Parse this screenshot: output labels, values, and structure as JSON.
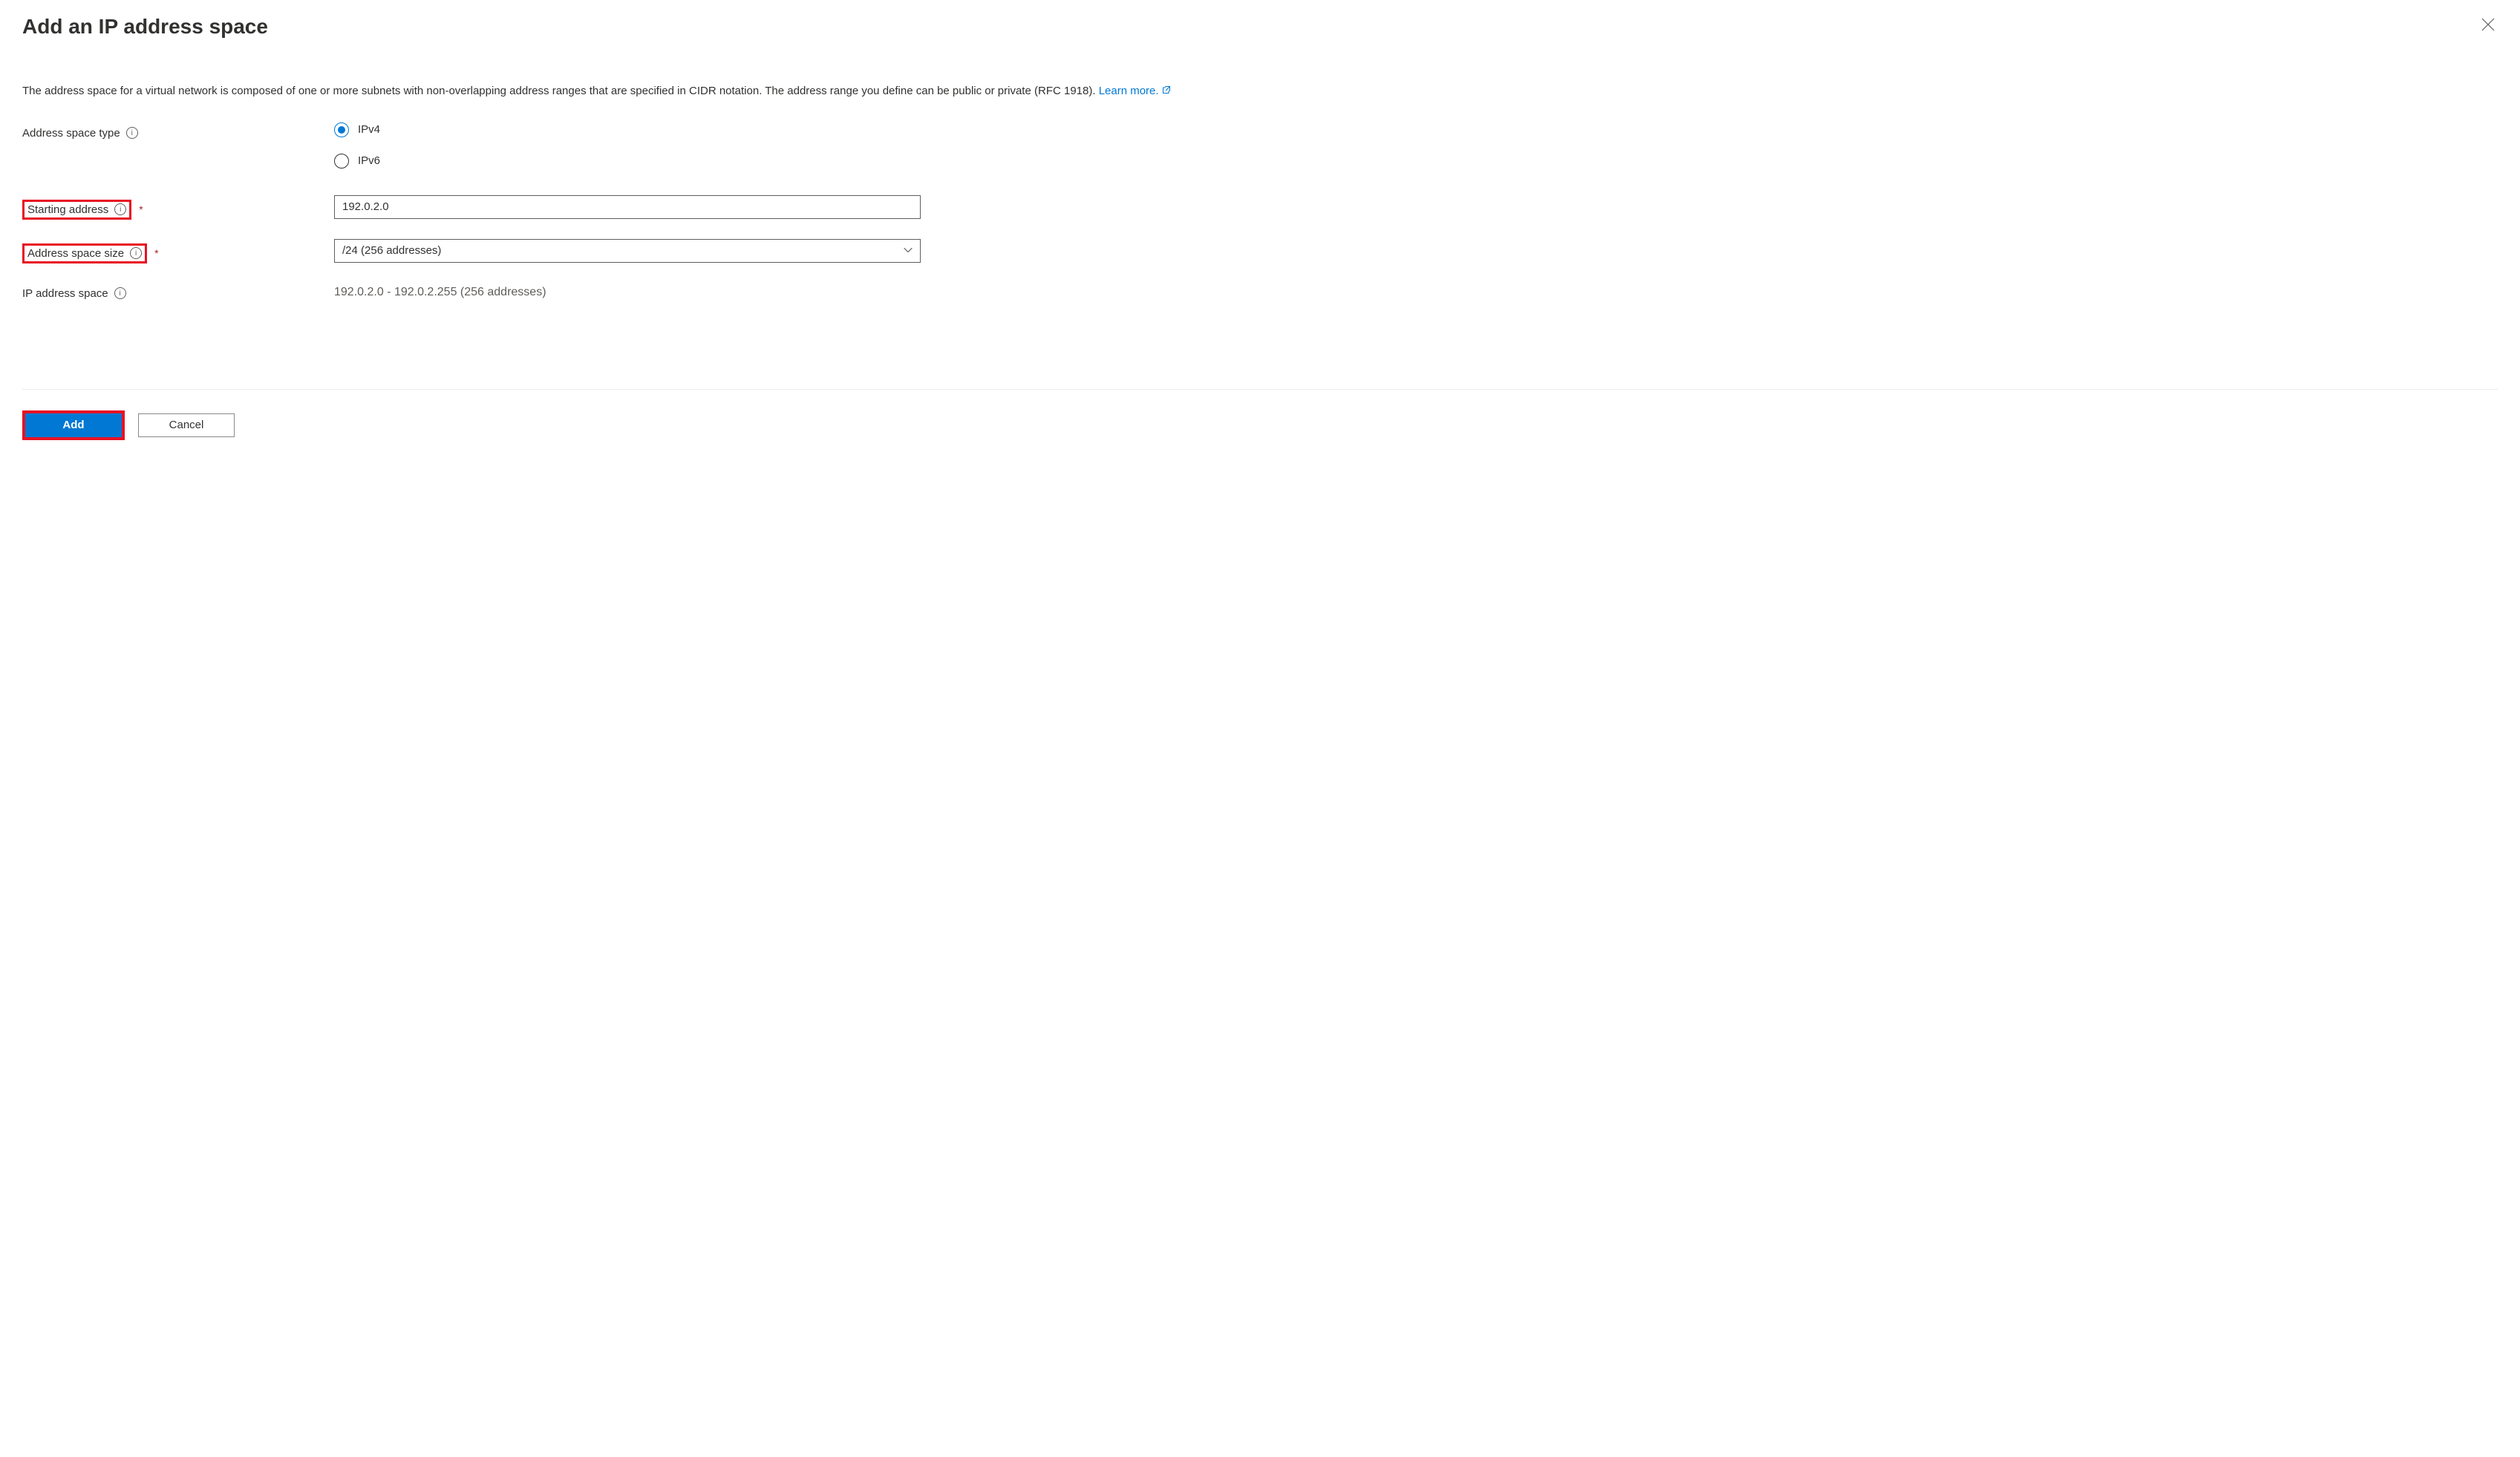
{
  "header": {
    "title": "Add an IP address space"
  },
  "description": {
    "text_before_link": "The address space for a virtual network is composed of one or more subnets with non-overlapping address ranges that are specified in CIDR notation. The address range you define can be public or private (RFC 1918). ",
    "link_text": "Learn more."
  },
  "fields": {
    "address_space_type": {
      "label": "Address space type",
      "options": {
        "ipv4": "IPv4",
        "ipv6": "IPv6"
      }
    },
    "starting_address": {
      "label": "Starting address",
      "value": "192.0.2.0"
    },
    "address_space_size": {
      "label": "Address space size",
      "value": "/24 (256 addresses)"
    },
    "ip_address_space": {
      "label": "IP address space",
      "value": "192.0.2.0 - 192.0.2.255 (256 addresses)"
    }
  },
  "footer": {
    "add": "Add",
    "cancel": "Cancel"
  }
}
